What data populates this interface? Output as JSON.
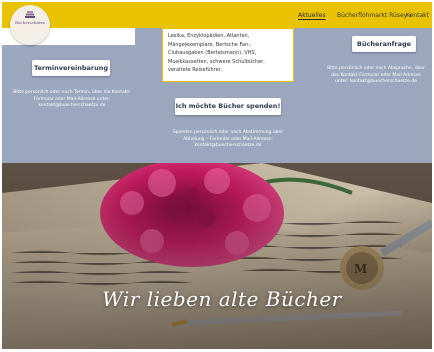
{
  "logo": {
    "text": "Bücherschätze",
    "icon": "book-stack-logo"
  },
  "nav": {
    "items": [
      {
        "label": "Aktuelles",
        "active": true
      },
      {
        "label": "Bücherflohmarkt Rüsey",
        "has_dropdown": true
      },
      {
        "label": "Kontakt",
        "active": false
      }
    ]
  },
  "center_card": {
    "text": "Lexika, Enzyklopädien, Atlanten, Mängelexemplare, Bertsche Fan-, Clubausgaben (Bertelsmann), VHS, Musikkassetten, schwere Schulbücher, veraltete Reiseführer."
  },
  "left": {
    "button": "Terminvereinbarung",
    "desc": "Bitte persönlich oder nach Termin, über die Kontakt-Formular oder Mail-Adresse unter: kontakt@buecherschaetze.de"
  },
  "middle": {
    "button": "Ich möchte Bücher spenden!",
    "desc": "Spenden persönlich oder nach Abstimmung über Abholung – Formular oder Mail-Adresse: kontakt@buecherschaetze.de"
  },
  "right": {
    "button": "Bücheranfrage",
    "desc": "Bitte persönlich oder nach Absprache, über das Kontakt-Formular oder Mail-Adresse unter: kontakt@buecherschaetze.de"
  },
  "hero": {
    "title": "Wir lieben alte Bücher"
  },
  "colors": {
    "header": "#e9c300",
    "section_bg": "#9aa7bf",
    "carnation": "#c2185b"
  }
}
